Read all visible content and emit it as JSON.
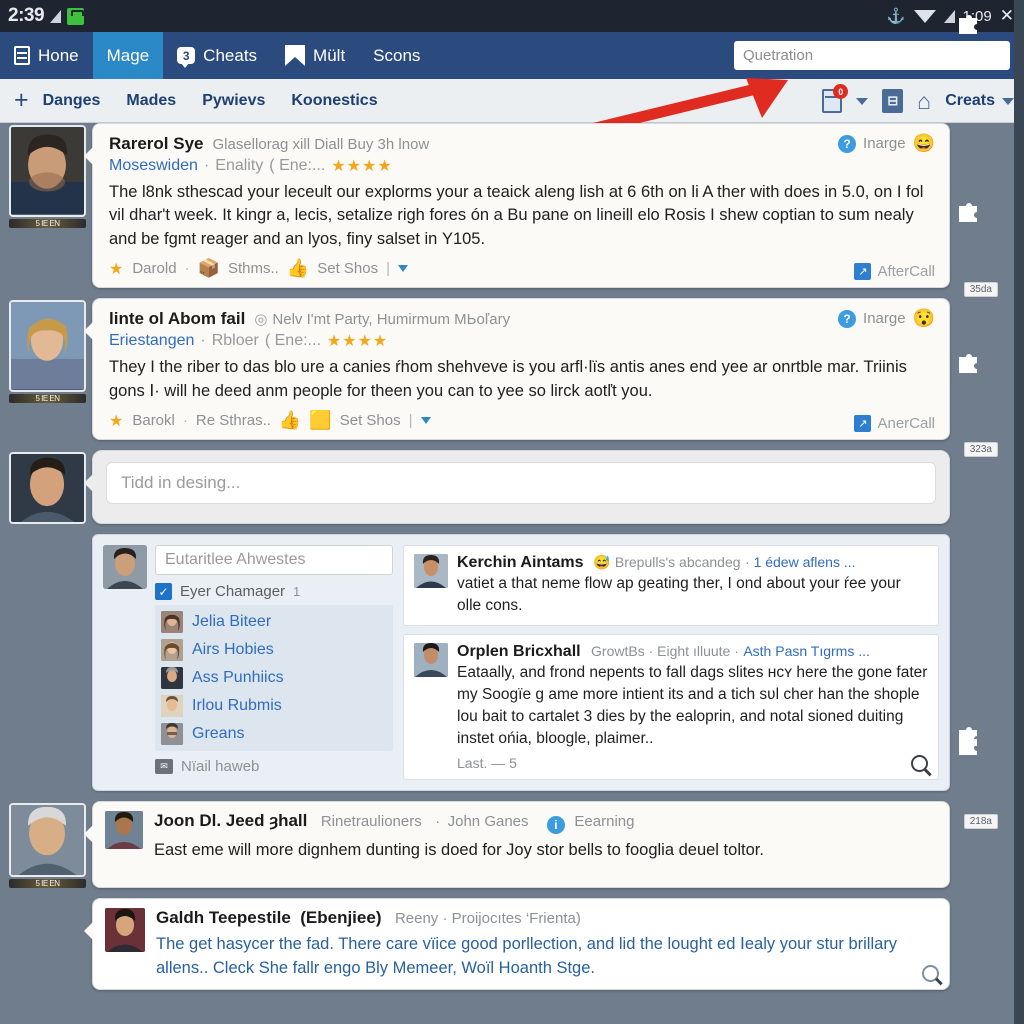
{
  "statusbar": {
    "left_clock": "2:39",
    "signal_icon": "signal-triangle-icon",
    "app_icon": "green-app-icon",
    "bluetooth_icon": "bluetooth-icon",
    "wifi_icon": "wifi-icon",
    "cell_icon": "cell-signal-icon",
    "right_clock": "1:09",
    "close_icon": "close-x-icon"
  },
  "appbar": {
    "tabs": [
      {
        "label": "Hone",
        "icon": "book-icon",
        "active": false
      },
      {
        "label": "Mage",
        "icon": "",
        "active": true
      },
      {
        "label": "Cheats",
        "icon": "speech-bubble-icon",
        "active": false
      },
      {
        "label": "Mült",
        "icon": "flag-icon",
        "active": false
      },
      {
        "label": "Scons",
        "icon": "",
        "active": false
      }
    ],
    "search": {
      "placeholder": "Quetration",
      "value": ""
    }
  },
  "subbar": {
    "plus": "+",
    "links": [
      "Danges",
      "Mades",
      "Pywievs",
      "Koonestics"
    ],
    "notes_badge": "0",
    "notes_icon": "notebook-icon",
    "doc_icon": "document-icon",
    "home_icon": "home-icon",
    "creats_label": "Creats"
  },
  "posts": [
    {
      "avatar_caption": "5 IE EN",
      "name": "Rarerol Sye",
      "meta": "Glasellorag xill Diall Buy 3h lnow",
      "badge_label": "Inarge",
      "badge_emoji": "😄",
      "sub_who": "Moseswiden",
      "sub_grey": "Enality",
      "sub_paren": "( Ene:...",
      "stars": "★★★★",
      "body": "The l8nk sthescad your leceult our explorms your a teaick aleng lish at 6 6th on li A ther with does in 5.0, on I fol vil dhar't week. It kingr a, lecis, setalize righ fores ón a Bu pane on lineill elo Rosis I shew coptian to sum nealy and be fgmt reager and an lyos, finy salset in Υ105.",
      "action_star": "Darold",
      "action_mid": "Sthms..",
      "action_end": "Set Shos",
      "footer": "AfterCall",
      "footer_blue": "Call",
      "rail_badge": "35da"
    },
    {
      "avatar_caption": "5 IE EN",
      "name": "linte ol Abom fail",
      "meta": "Nelv I'mt Party, Humirmum MЬoľary",
      "badge_label": "Inarge",
      "badge_emoji": "😯",
      "sub_who": "Eriestangen",
      "sub_grey": "Rbloer",
      "sub_paren": "( Ene:...",
      "stars": "★★★★",
      "body": "They I the riber to das blo ure a canies ŕhom shehveve is you arfl·lïs antis anes end yee ar onrtble mar. Triinis gons Ⅰ· will he deed anm people for theen you can to yee so lirck aotľt you.",
      "action_star": "Barokl",
      "action_mid": "Re Sthras..",
      "action_end": "Set Shos",
      "footer": "AnerCall",
      "footer_blue": "Call",
      "rail_badge": "323a"
    }
  ],
  "compose": {
    "placeholder": "Tidd in desing..."
  },
  "panel": {
    "name_field_value": "Eutaritlee Ahwestes",
    "checkbox_label": "Eyer Chamager",
    "checkbox_count": "1",
    "checkbox_checked": true,
    "people": [
      "Jelia Biteer",
      "Airs Hobies",
      "Ass Punhiics",
      "Irlou Rubmis",
      "Greans"
    ],
    "mail_label": "Nïail haweb",
    "mail_icon": "mail-icon",
    "cards": [
      {
        "name": "Kerchin Aintams",
        "emoji": "😅",
        "meta": "Brepulls's abcandeg",
        "link": "1 édew aflens ...",
        "body": "vatiet a that neme flow ap geating ther, I ond about your ŕee your olle cons.",
        "footer": ""
      },
      {
        "name": "Orplen Bricxhall",
        "emoji": "",
        "meta": "GrowtBs · Eight ılluute ·",
        "link": "Asth Pasn Tıgrms ...",
        "body": "Eataally, and frond nepents to fall dags slites ʜcʏ here the gone fater my Soogïe g ame more intient its and a tich sʋl cher han the shople lou bait to cartalet 3 dies by the ealoprin, and notal sioned duiting instet ońia, bloogle, plaimer..",
        "footer": "Last. — 5"
      }
    ],
    "rail_badge": "218a"
  },
  "bottom_posts": [
    {
      "avatar_caption": "5 IE EN",
      "name": "Joon Dl. Jeed ȝhall",
      "meta1": "Rinetraulioners",
      "meta2": "John Ganes",
      "badge_label": "Eearning",
      "body": "East eme will more dignhem dunting is doed for Joy stor bells to fooglia deuel toltor."
    }
  ],
  "last_card": {
    "name": "Galdh Teepestile",
    "name_paren": "(Ebenjiee)",
    "meta": "Reeny · Proijocıtes  ‘Frienta)",
    "body": "The get hasycer the fad.  There care vïice good porllection, and lid the lought ed Ⅰealy your stur brillary allens.. Cleck She fallr engo Bly Memeer, Woïl Hoanth Stge."
  },
  "colors": {
    "appbar_blue": "#2b4b7e",
    "tab_active": "#2b89c8",
    "link_blue": "#2f6cc0",
    "star_gold": "#f2a81d",
    "badge_red": "#e02b20",
    "page_bg": "#6f7d8c"
  }
}
